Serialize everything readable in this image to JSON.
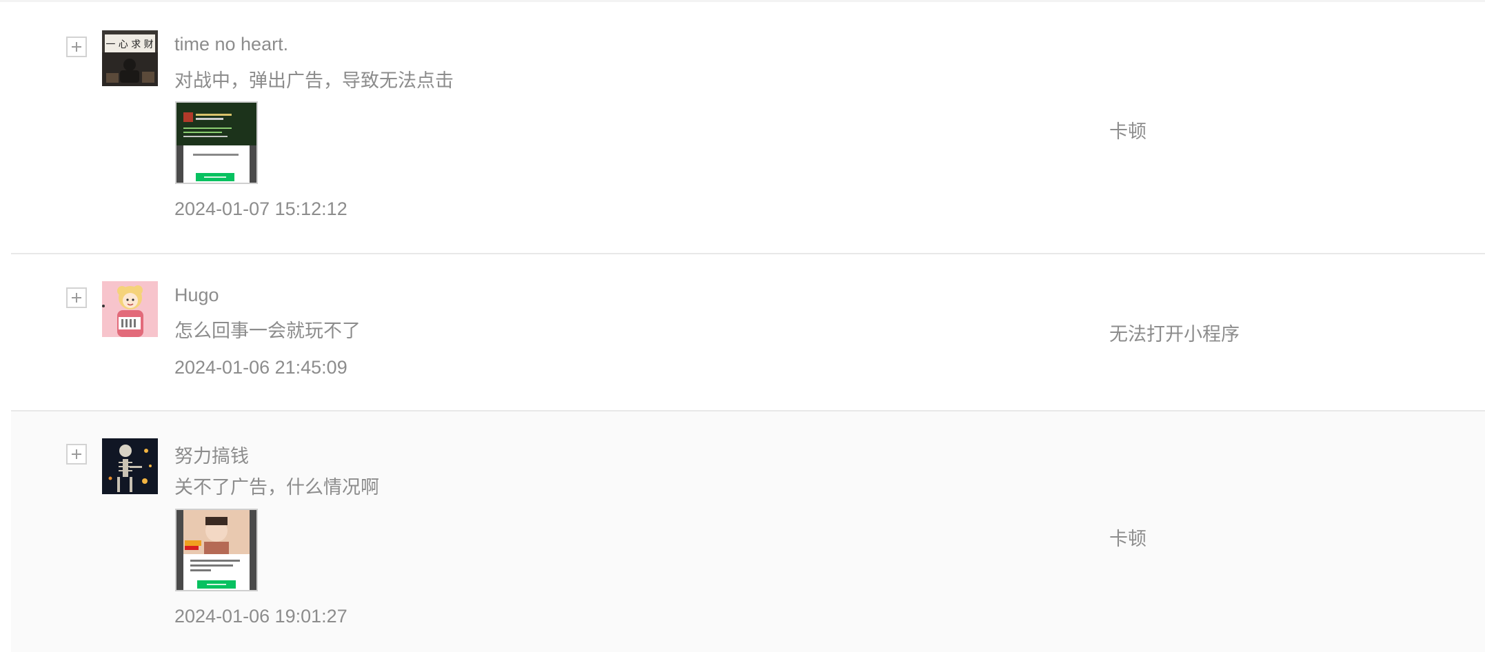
{
  "feedback_list": [
    {
      "username": "time no heart.",
      "content": "对战中，弹出广告，导致无法点击",
      "has_screenshot": true,
      "timestamp": "2024-01-07 15:12:12",
      "category": "卡顿"
    },
    {
      "username": "Hugo",
      "content": "怎么回事一会就玩不了",
      "has_screenshot": false,
      "timestamp": "2024-01-06 21:45:09",
      "category": "无法打开小程序"
    },
    {
      "username": "努力搞钱",
      "content": "关不了广告，什么情况啊",
      "has_screenshot": true,
      "timestamp": "2024-01-06 19:01:27",
      "category": "卡顿"
    }
  ],
  "icons": {
    "expand": "plus-square-icon"
  },
  "colors": {
    "text": "#8c8c8c",
    "divider": "#e8e8e8",
    "row_highlight": "#fafafa",
    "ad_button_green": "#07c160"
  }
}
